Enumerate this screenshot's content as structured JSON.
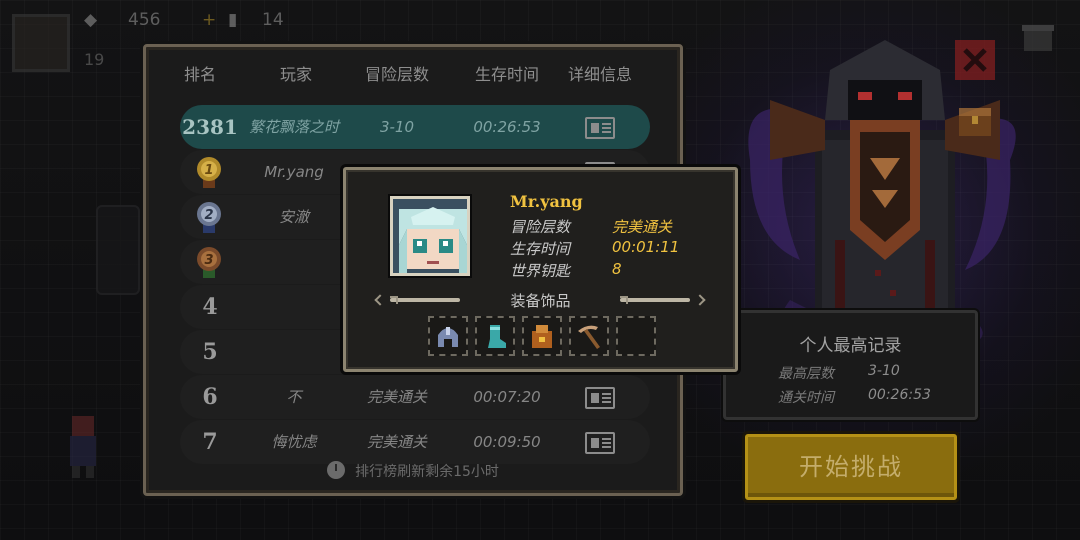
{
  "hud": {
    "gems": "456",
    "keys": "14",
    "second_row": "19"
  },
  "leaderboard": {
    "headers": {
      "rank": "排名",
      "player": "玩家",
      "floor": "冒险层数",
      "time": "生存时间",
      "detail": "详细信息"
    },
    "my_row": {
      "rank": "2381",
      "player": "繁花飘落之时",
      "floor": "3-10",
      "time": "00:26:53"
    },
    "rows": [
      {
        "rank": "1",
        "player": "Mr.yang",
        "floor": "完美通关",
        "time": "00:01:11"
      },
      {
        "rank": "2",
        "player": "安澈",
        "floor": "",
        "time": ""
      },
      {
        "rank": "3",
        "player": "",
        "floor": "",
        "time": ""
      },
      {
        "rank": "4",
        "player": "",
        "floor": "",
        "time": ""
      },
      {
        "rank": "5",
        "player": "",
        "floor": "",
        "time": ""
      },
      {
        "rank": "6",
        "player": "不",
        "floor": "完美通关",
        "time": "00:07:20"
      },
      {
        "rank": "7",
        "player": "悔忧虑",
        "floor": "完美通关",
        "time": "00:09:50"
      }
    ],
    "refresh_note": "排行榜刷新剩余15小时"
  },
  "popup": {
    "name": "Mr.yang",
    "floor_label": "冒险层数",
    "floor_value": "完美通关",
    "time_label": "生存时间",
    "time_value": "00:01:11",
    "keys_label": "世界钥匙",
    "keys_value": "8",
    "equip_title": "装备饰品",
    "equipment": [
      "helmet-icon",
      "boots-icon",
      "bag-icon",
      "pickaxe-icon",
      "empty-slot"
    ]
  },
  "personal_best": {
    "title": "个人最高记录",
    "floor_label": "最高层数",
    "floor_value": "3-10",
    "time_label": "通关时间",
    "time_value": "00:26:53"
  },
  "start_button": "开始挑战",
  "colors": {
    "gold": "#f0c240",
    "my_row": "#1e4a4a",
    "button": "#8a6d0e"
  }
}
